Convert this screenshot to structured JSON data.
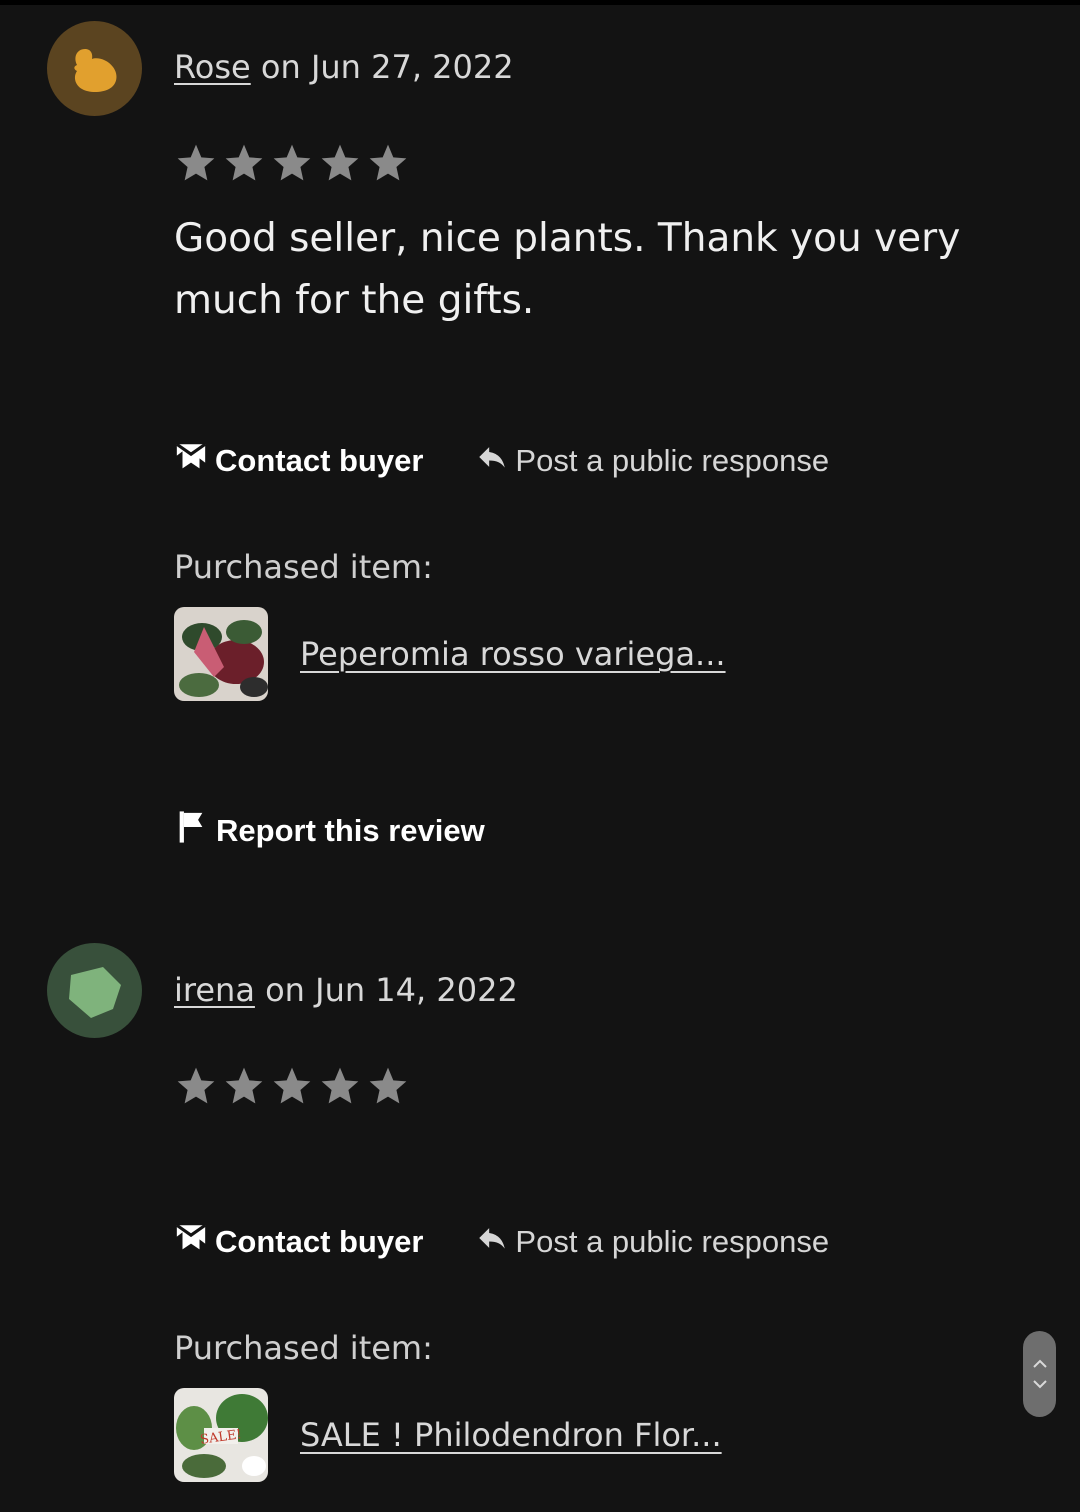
{
  "reviews": [
    {
      "reviewer": "Rose",
      "date_text": " on Jun 27, 2022",
      "rating": 5,
      "text": "Good seller, nice plants. Thank you very much for the gifts.",
      "contact_label": "Contact buyer",
      "respond_label": "Post a public response",
      "purchased_label": "Purchased item:",
      "item_title": "Peperomia rosso variega...",
      "report_label": "Report this review",
      "avatar_color": "#5b4420",
      "avatar_shape_color": "#e1a02e"
    },
    {
      "reviewer": "irena",
      "date_text": " on Jun 14, 2022",
      "rating": 5,
      "contact_label": "Contact buyer",
      "respond_label": "Post a public response",
      "purchased_label": "Purchased item:",
      "item_title": "SALE ! Philodendron Flor...",
      "avatar_color": "#38503b",
      "avatar_shape_color": "#7fb37c"
    }
  ],
  "colors": {
    "background": "#131313",
    "star": "#8a8a8a",
    "text": "#e9e9e9"
  },
  "icons": {
    "contact": "envelope-icon",
    "respond": "reply-arrow-icon",
    "report": "flag-icon",
    "scroll_up": "chevron-up-icon",
    "scroll_down": "chevron-down-icon"
  }
}
